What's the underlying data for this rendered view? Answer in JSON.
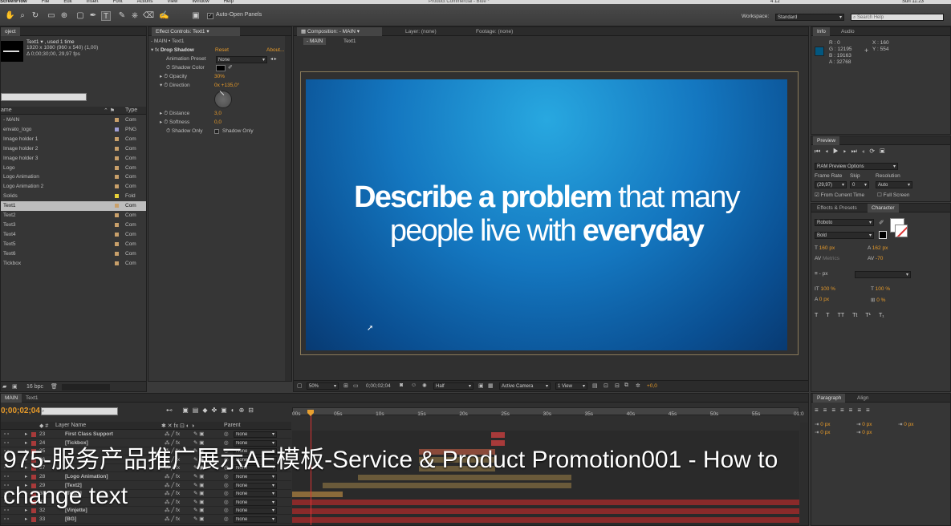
{
  "app": {
    "menu": [
      "ScreenFlow",
      "File",
      "Edit",
      "Insert",
      "Font",
      "Actions",
      "View",
      "Window",
      "Help"
    ],
    "window_title": "Product Commercial - Blue *",
    "clock": "Sun 11:23",
    "status": "4 12"
  },
  "toolbar": {
    "auto_open_label": "Auto-Open Panels",
    "workspace_label": "Workspace:",
    "workspace_value": "Standard",
    "search_placeholder": "Search Help"
  },
  "project": {
    "tab": "oject",
    "item_name": "Text1 ▾ , used 1 time",
    "item_dims": "1920 x 1080  (960 x 540) (1,00)",
    "item_duration": "Δ 0;00;30;00, 29,97 fps",
    "col_name": "ame",
    "col_type": "Type",
    "items": [
      {
        "name": "- MAIN",
        "type": "Com",
        "color": "#c9a06a"
      },
      {
        "name": "envato_logo",
        "type": "PNG",
        "color": "#9e9ed6"
      },
      {
        "name": "Image holder 1",
        "type": "Com",
        "color": "#c9a06a"
      },
      {
        "name": "Image holder 2",
        "type": "Com",
        "color": "#c9a06a"
      },
      {
        "name": "Image holder 3",
        "type": "Com",
        "color": "#c9a06a"
      },
      {
        "name": "Logo",
        "type": "Com",
        "color": "#c9a06a"
      },
      {
        "name": "Logo Animation",
        "type": "Com",
        "color": "#c9a06a"
      },
      {
        "name": "Logo Animation 2",
        "type": "Com",
        "color": "#c9a06a"
      },
      {
        "name": "Solids",
        "type": "Fold",
        "color": "#e8d238"
      },
      {
        "name": "Text1",
        "type": "Com",
        "color": "#c9a06a",
        "selected": true
      },
      {
        "name": "Text2",
        "type": "Com",
        "color": "#c9a06a"
      },
      {
        "name": "Text3",
        "type": "Com",
        "color": "#c9a06a"
      },
      {
        "name": "Text4",
        "type": "Com",
        "color": "#c9a06a"
      },
      {
        "name": "Text5",
        "type": "Com",
        "color": "#c9a06a"
      },
      {
        "name": "Text6",
        "type": "Com",
        "color": "#c9a06a"
      },
      {
        "name": "Tickbox",
        "type": "Com",
        "color": "#c9a06a"
      }
    ],
    "bpc": "16 bpc"
  },
  "effects": {
    "tab": "Effect Controls: Text1",
    "breadcrumb": "- MAIN • Text1",
    "effect_name": "Drop Shadow",
    "reset": "Reset",
    "about": "About...",
    "preset_label": "Animation Preset",
    "preset_value": "None",
    "shadow_color_label": "Shadow Color",
    "opacity_label": "Opacity",
    "opacity_value": "30%",
    "direction_label": "Direction",
    "direction_value": "0x +135,0°",
    "distance_label": "Distance",
    "distance_value": "3,0",
    "softness_label": "Softness",
    "softness_value": "0,0",
    "shadow_only_label": "Shadow Only",
    "shadow_only_check": "Shadow Only"
  },
  "composition": {
    "tab": "Composition: - MAIN",
    "layer_tab": "Layer: (none)",
    "footage_tab": "Footage: (none)",
    "crumb_main": "- MAIN",
    "crumb_text": "Text1",
    "line1_bold": "Describe a problem",
    "line1_light": " that many",
    "line2_light": "people live with ",
    "line2_bold": "everyday",
    "zoom": "50%",
    "timecode": "0;00;02;04",
    "resolution": "Half",
    "camera": "Active Camera",
    "view": "1 View",
    "exposure": "+0,0"
  },
  "info": {
    "tab_info": "Info",
    "tab_audio": "Audio",
    "r": "R : 0",
    "g": "G : 12195",
    "b": "B : 19163",
    "a": "A : 32768",
    "x": "X : 160",
    "y": "Y : 554",
    "color": "#03577f"
  },
  "preview": {
    "tab": "Preview",
    "ram_options": "RAM Preview Options",
    "frame_rate_label": "Frame Rate",
    "skip_label": "Skip",
    "resolution_label": "Resolution",
    "frame_rate_value": "(29,97)",
    "skip_value": "0",
    "resolution_value": "Auto",
    "from_current": "From Current Time",
    "full_screen": "Full Screen"
  },
  "character": {
    "tab_effects": "Effects & Presets",
    "tab_character": "Character",
    "font": "Roboto",
    "style": "Bold",
    "size": "160 px",
    "leading": "162 px",
    "kerning": "Metrics",
    "tracking": "-70",
    "stroke": "- px",
    "vscale": "100 %",
    "hscale": "100 %",
    "baseline": "0 px",
    "tsume": "0 %",
    "styles": [
      "T",
      "T",
      "TT",
      "Tt",
      "T¹",
      "T₁"
    ]
  },
  "paragraph": {
    "tab_paragraph": "Paragraph",
    "tab_align": "Align",
    "indent_values": [
      "0 px",
      "0 px",
      "0 px",
      "0 px",
      "0 px"
    ]
  },
  "timeline": {
    "tab_main": "MAIN",
    "tab_text1": "Text1",
    "timecode": "0;00;02;04",
    "col_layer": "Layer Name",
    "col_parent": "Parent",
    "ruler": [
      "00s",
      "05s",
      "10s",
      "15s",
      "20s",
      "25s",
      "30s",
      "35s",
      "40s",
      "45s",
      "50s",
      "55s",
      "01:0"
    ],
    "layers": [
      {
        "num": "23",
        "name": "First Class Support",
        "parent": "None",
        "bar_start": 0.392,
        "bar_end": 0.42,
        "color": "#a83a3a"
      },
      {
        "num": "24",
        "name": "[Tickbox]",
        "parent": "None",
        "bar_start": 0.392,
        "bar_end": 0.42,
        "color": "#a83a3a"
      },
      {
        "num": "25",
        "name": "",
        "parent": "None",
        "bar_start": 0.25,
        "bar_end": 0.4,
        "color": "#8a4a3a"
      },
      {
        "num": "26",
        "name": "",
        "parent": "None",
        "bar_start": 0.25,
        "bar_end": 0.4,
        "color": "#6a5a3a"
      },
      {
        "num": "27",
        "name": "",
        "parent": "None",
        "bar_start": 0.25,
        "bar_end": 0.4,
        "color": "#6a5a3a"
      },
      {
        "num": "28",
        "name": "[Logo Animation]",
        "parent": "None",
        "bar_start": 0.13,
        "bar_end": 0.55,
        "color": "#6a5a3a"
      },
      {
        "num": "29",
        "name": "[Text2]",
        "parent": "None",
        "bar_start": 0.06,
        "bar_end": 0.55,
        "color": "#6a5a3a"
      },
      {
        "num": "30",
        "name": "[Text1]",
        "parent": "None",
        "bar_start": 0.0,
        "bar_end": 0.1,
        "color": "#8a6a3a"
      },
      {
        "num": "31",
        "name": "",
        "parent": "None",
        "bar_start": 0.0,
        "bar_end": 1.0,
        "color": "#8a2a2a"
      },
      {
        "num": "32",
        "name": "[Vinjette]",
        "parent": "None",
        "bar_start": 0.0,
        "bar_end": 1.0,
        "color": "#8a2a2a"
      },
      {
        "num": "33",
        "name": "[BG]",
        "parent": "None",
        "bar_start": 0.0,
        "bar_end": 1.0,
        "color": "#8a2a2a"
      }
    ]
  },
  "caption": {
    "line1": "975-服务产品推广展示AE模板-Service & Product Promotion001 - How to",
    "line2": "change text"
  }
}
